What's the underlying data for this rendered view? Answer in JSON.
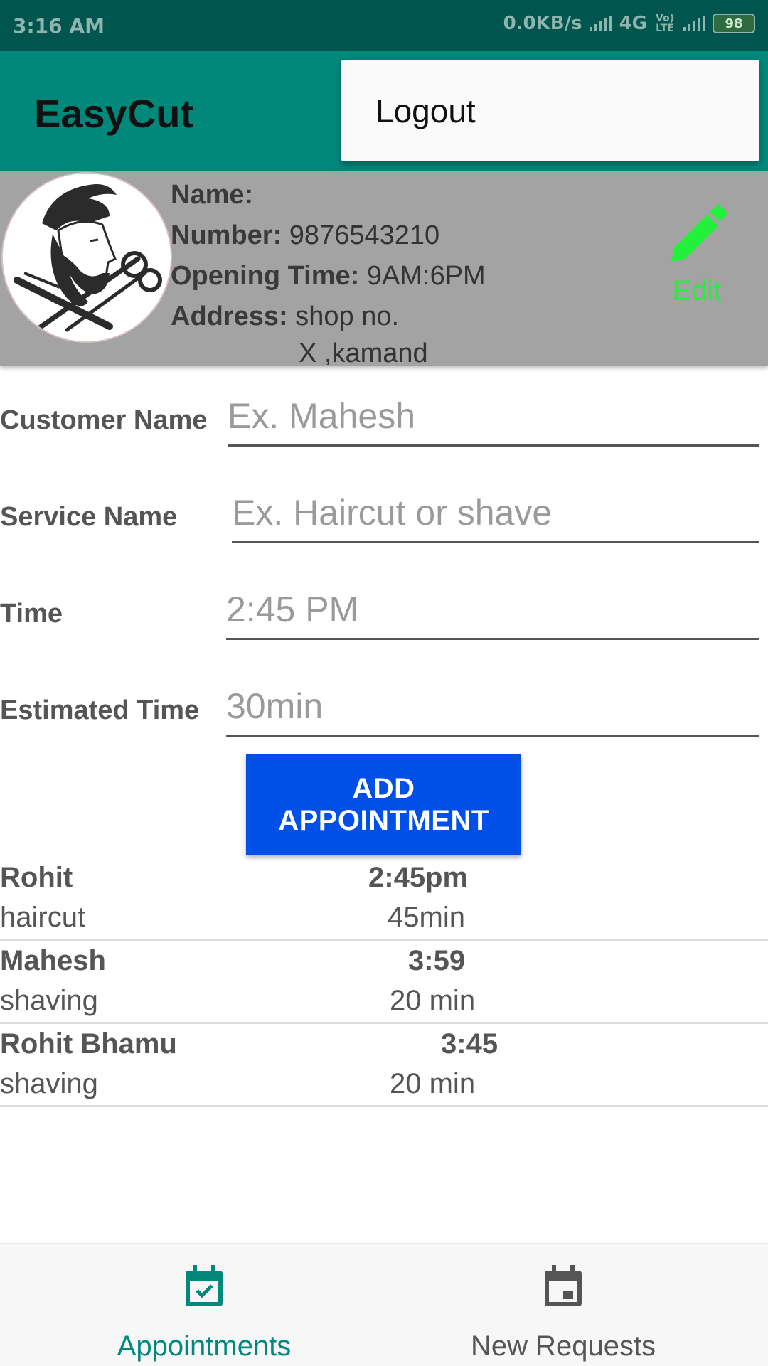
{
  "status_bar": {
    "time": "3:16 AM",
    "network_speed": "0.0KB/s",
    "network_type": "4G",
    "volte": "Vo) LTE",
    "battery": "98"
  },
  "app_bar": {
    "title": "EasyCut"
  },
  "overflow_menu": {
    "items": [
      {
        "label": "Logout"
      }
    ]
  },
  "profile": {
    "name_label": "Name:",
    "name_value": "",
    "number_label": "Number:",
    "number_value": "9876543210",
    "opening_label": "Opening Time:",
    "opening_value": "9AM:6PM",
    "address_label": "Address:",
    "address_line1": "shop no.",
    "address_line2": "X ,kamand",
    "edit_label": "Edit"
  },
  "form": {
    "customer_name": {
      "label": "Customer Name",
      "placeholder": "Ex. Mahesh"
    },
    "service_name": {
      "label": "Service Name",
      "placeholder": "Ex. Haircut or shave"
    },
    "time": {
      "label": "Time",
      "placeholder": "2:45 PM"
    },
    "estimated_time": {
      "label": "Estimated Time",
      "placeholder": "30min"
    },
    "add_button": "ADD APPOINTMENT"
  },
  "appointments": [
    {
      "name": "Rohit",
      "service": "haircut",
      "time": "2:45pm",
      "duration": "45min"
    },
    {
      "name": "Mahesh",
      "service": "shaving",
      "time": "3:59",
      "duration": "20 min"
    },
    {
      "name": "Rohit Bhamu",
      "service": "shaving",
      "time": "3:45",
      "duration": "20 min"
    }
  ],
  "bottom_nav": {
    "items": [
      {
        "label": "Appointments",
        "icon": "calendar-check-icon",
        "active": true
      },
      {
        "label": "New Requests",
        "icon": "calendar-event-icon",
        "active": false
      }
    ]
  },
  "colors": {
    "status_bar": "#00564e",
    "app_bar": "#00897b",
    "accent": "#00897b",
    "button": "#0050e8",
    "edit": "#22f03a"
  }
}
